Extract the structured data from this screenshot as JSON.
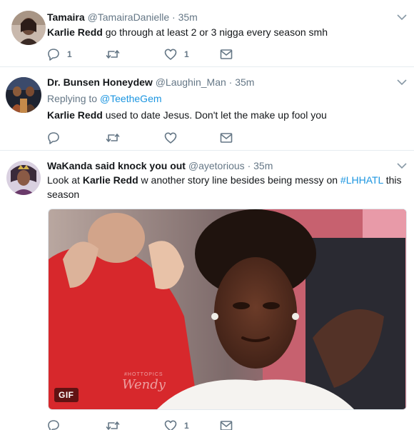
{
  "tweets": [
    {
      "name": "Tamaira",
      "handle": "@TamairaDanielle",
      "dot": "·",
      "time": "35m",
      "mention": "Karlie Redd",
      "text": " go through at least 2 or 3 nigga every season smh",
      "reply_count": "1",
      "like_count": "1"
    },
    {
      "name": "Dr. Bunsen Honeydew",
      "handle": "@Laughin_Man",
      "dot": "·",
      "time": "35m",
      "replying_label": "Replying to ",
      "replying_to": "@TeetheGem",
      "mention": "Karlie Redd",
      "text": " used to date Jesus. Don't let the make up fool you"
    },
    {
      "name": "WaKanda said knock you out",
      "handle": "@ayetorious",
      "dot": "·",
      "time": "35m",
      "text_pre": "Look at ",
      "mention": "Karlie Redd",
      "text_mid": " w another story line besides being messy on ",
      "hashtag": "#LHHATL",
      "text_post": " this season",
      "media_badge": "GIF",
      "watermark": "Wendy",
      "watermark_small": "#HOTTOPICS",
      "like_count": "1"
    }
  ],
  "colors": {
    "accent": "#1b95e0",
    "secondary_text": "#657786",
    "divider": "#e6ecf0"
  },
  "icons": [
    "reply-icon",
    "retweet-icon",
    "like-icon",
    "direct-message-icon",
    "chevron-down-icon"
  ]
}
